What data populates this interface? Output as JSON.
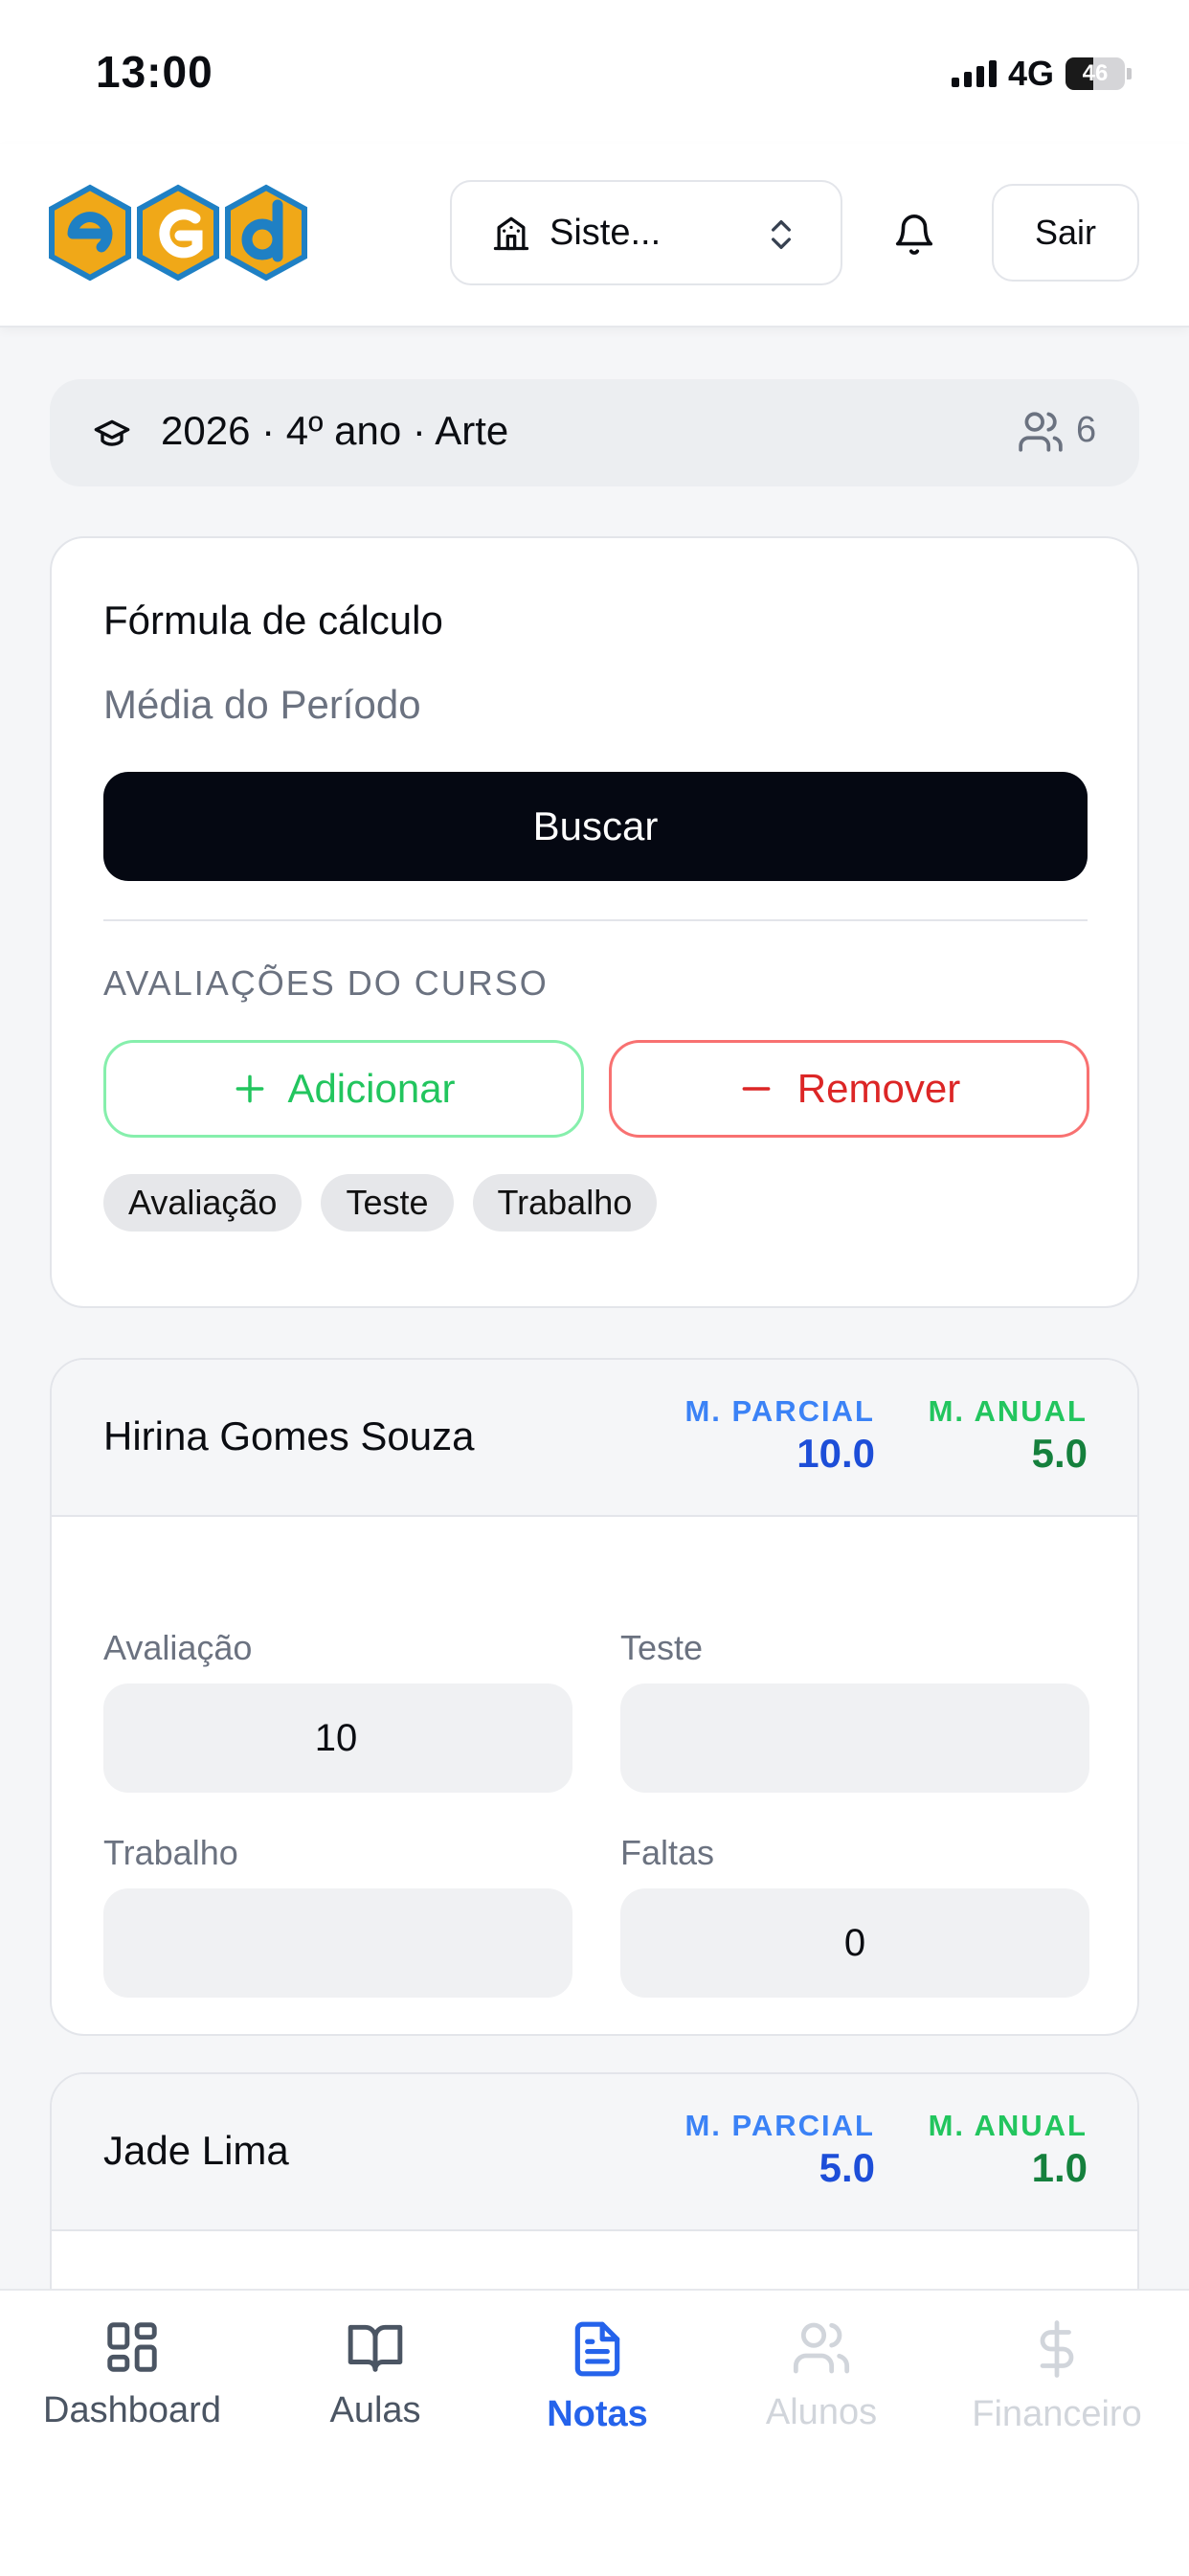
{
  "status_bar": {
    "time": "13:00",
    "network": "4G",
    "battery": "46",
    "battery_level": 0.46
  },
  "header": {
    "logo_icon": "egd-logo",
    "school_selector": {
      "value": "Siste...",
      "icon": "building-icon"
    },
    "notification_icon": "bell-icon",
    "logout_label": "Sair"
  },
  "class_bar": {
    "context": "2026 · 4º ano · Arte",
    "student_count": "6",
    "icon": "graduation-cap-icon"
  },
  "formula": {
    "title": "Fórmula de cálculo",
    "value": "Média do Período",
    "search_label": "Buscar",
    "evaluations_title": "AVALIAÇÕES DO CURSO",
    "add_label": "Adicionar",
    "remove_label": "Remover",
    "tags": [
      "Avaliação",
      "Teste",
      "Trabalho"
    ]
  },
  "students": [
    {
      "name": "Hirina Gomes Souza",
      "partial_label": "M. PARCIAL",
      "partial": "10.0",
      "annual_label": "M. ANUAL",
      "annual": "5.0",
      "fields": [
        {
          "label": "Avaliação",
          "value": "10"
        },
        {
          "label": "Teste",
          "value": ""
        },
        {
          "label": "Trabalho",
          "value": ""
        },
        {
          "label": "Faltas",
          "value": "0"
        }
      ]
    },
    {
      "name": "Jade Lima",
      "partial_label": "M. PARCIAL",
      "partial": "5.0",
      "annual_label": "M. ANUAL",
      "annual": "1.0"
    }
  ],
  "colors": {
    "accent": "#2563eb",
    "partial": "#1d4ed8",
    "annual": "#15803d",
    "add": "#22c55e",
    "remove": "#dc2626"
  },
  "tabs": [
    {
      "label": "Dashboard",
      "icon": "grid-icon",
      "state": "inactive"
    },
    {
      "label": "Aulas",
      "icon": "book-open-icon",
      "state": "inactive"
    },
    {
      "label": "Notas",
      "icon": "file-text-icon",
      "state": "active"
    },
    {
      "label": "Alunos",
      "icon": "users-icon",
      "state": "disabled"
    },
    {
      "label": "Financeiro",
      "icon": "dollar-icon",
      "state": "disabled"
    }
  ]
}
